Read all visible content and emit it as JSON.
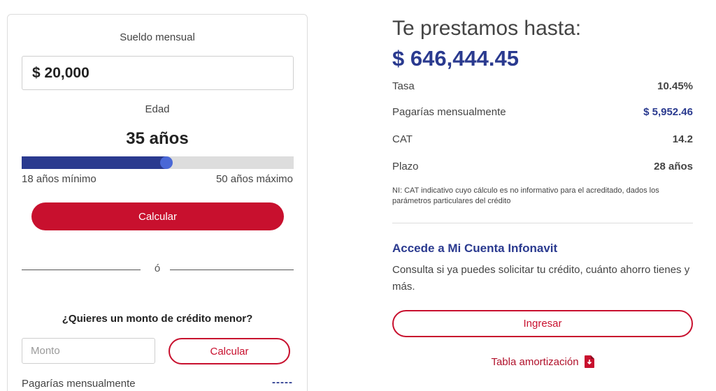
{
  "calculator": {
    "salary_label": "Sueldo mensual",
    "salary_value": "$ 20,000",
    "age_label": "Edad",
    "age_value": "35 años",
    "age_slider": {
      "min": 18,
      "max": 50,
      "value": 35
    },
    "min_label": "18 años mínimo",
    "max_label": "50 años máximo",
    "calc_button": "Calcular",
    "or_text": "ó",
    "smaller_question": "¿Quieres un monto de crédito menor?",
    "monto_placeholder": "Monto",
    "calc_button_2": "Calcular",
    "monthly_label": "Pagarías mensualmente",
    "monthly_value": "-----"
  },
  "results": {
    "heading": "Te prestamos hasta:",
    "amount": "$ 646,444.45",
    "rows": [
      {
        "label": "Tasa",
        "value": "10.45%"
      },
      {
        "label": "Pagarías mensualmente",
        "value": "$ 5,952.46"
      },
      {
        "label": "CAT",
        "value": "14.2"
      },
      {
        "label": "Plazo",
        "value": "28 años"
      }
    ],
    "note": "NI: CAT indicativo cuyo cálculo es no informativo para el acreditado, dados los parámetros particulares del crédito"
  },
  "account": {
    "title": "Accede a Mi Cuenta Infonavit",
    "description": "Consulta si ya puedes solicitar tu crédito, cuánto ahorro tienes y más.",
    "login_button": "Ingresar",
    "amortization_link": "Tabla amortización",
    "amortization_icon": "pdf-file-icon"
  },
  "colors": {
    "brand_red": "#c8102e",
    "brand_blue": "#2a3a8f",
    "slider_thumb": "#4a68d6"
  }
}
